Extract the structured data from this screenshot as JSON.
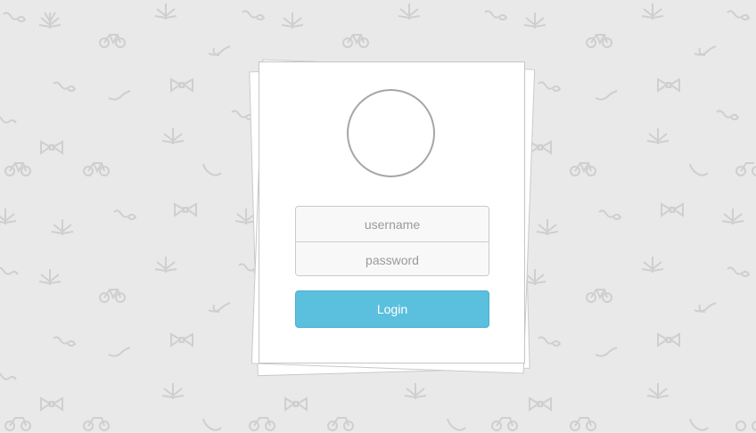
{
  "login_form": {
    "username_placeholder": "username",
    "password_placeholder": "password",
    "login_label": "Login"
  },
  "colors": {
    "background": "#e9e9e9",
    "button": "#5bc0de",
    "pattern_stroke": "#cfcfcf"
  },
  "background_pattern_icons": [
    "leaf-icon",
    "bicycle-icon",
    "mustache-icon",
    "pipe-icon",
    "bow-tie-icon"
  ]
}
